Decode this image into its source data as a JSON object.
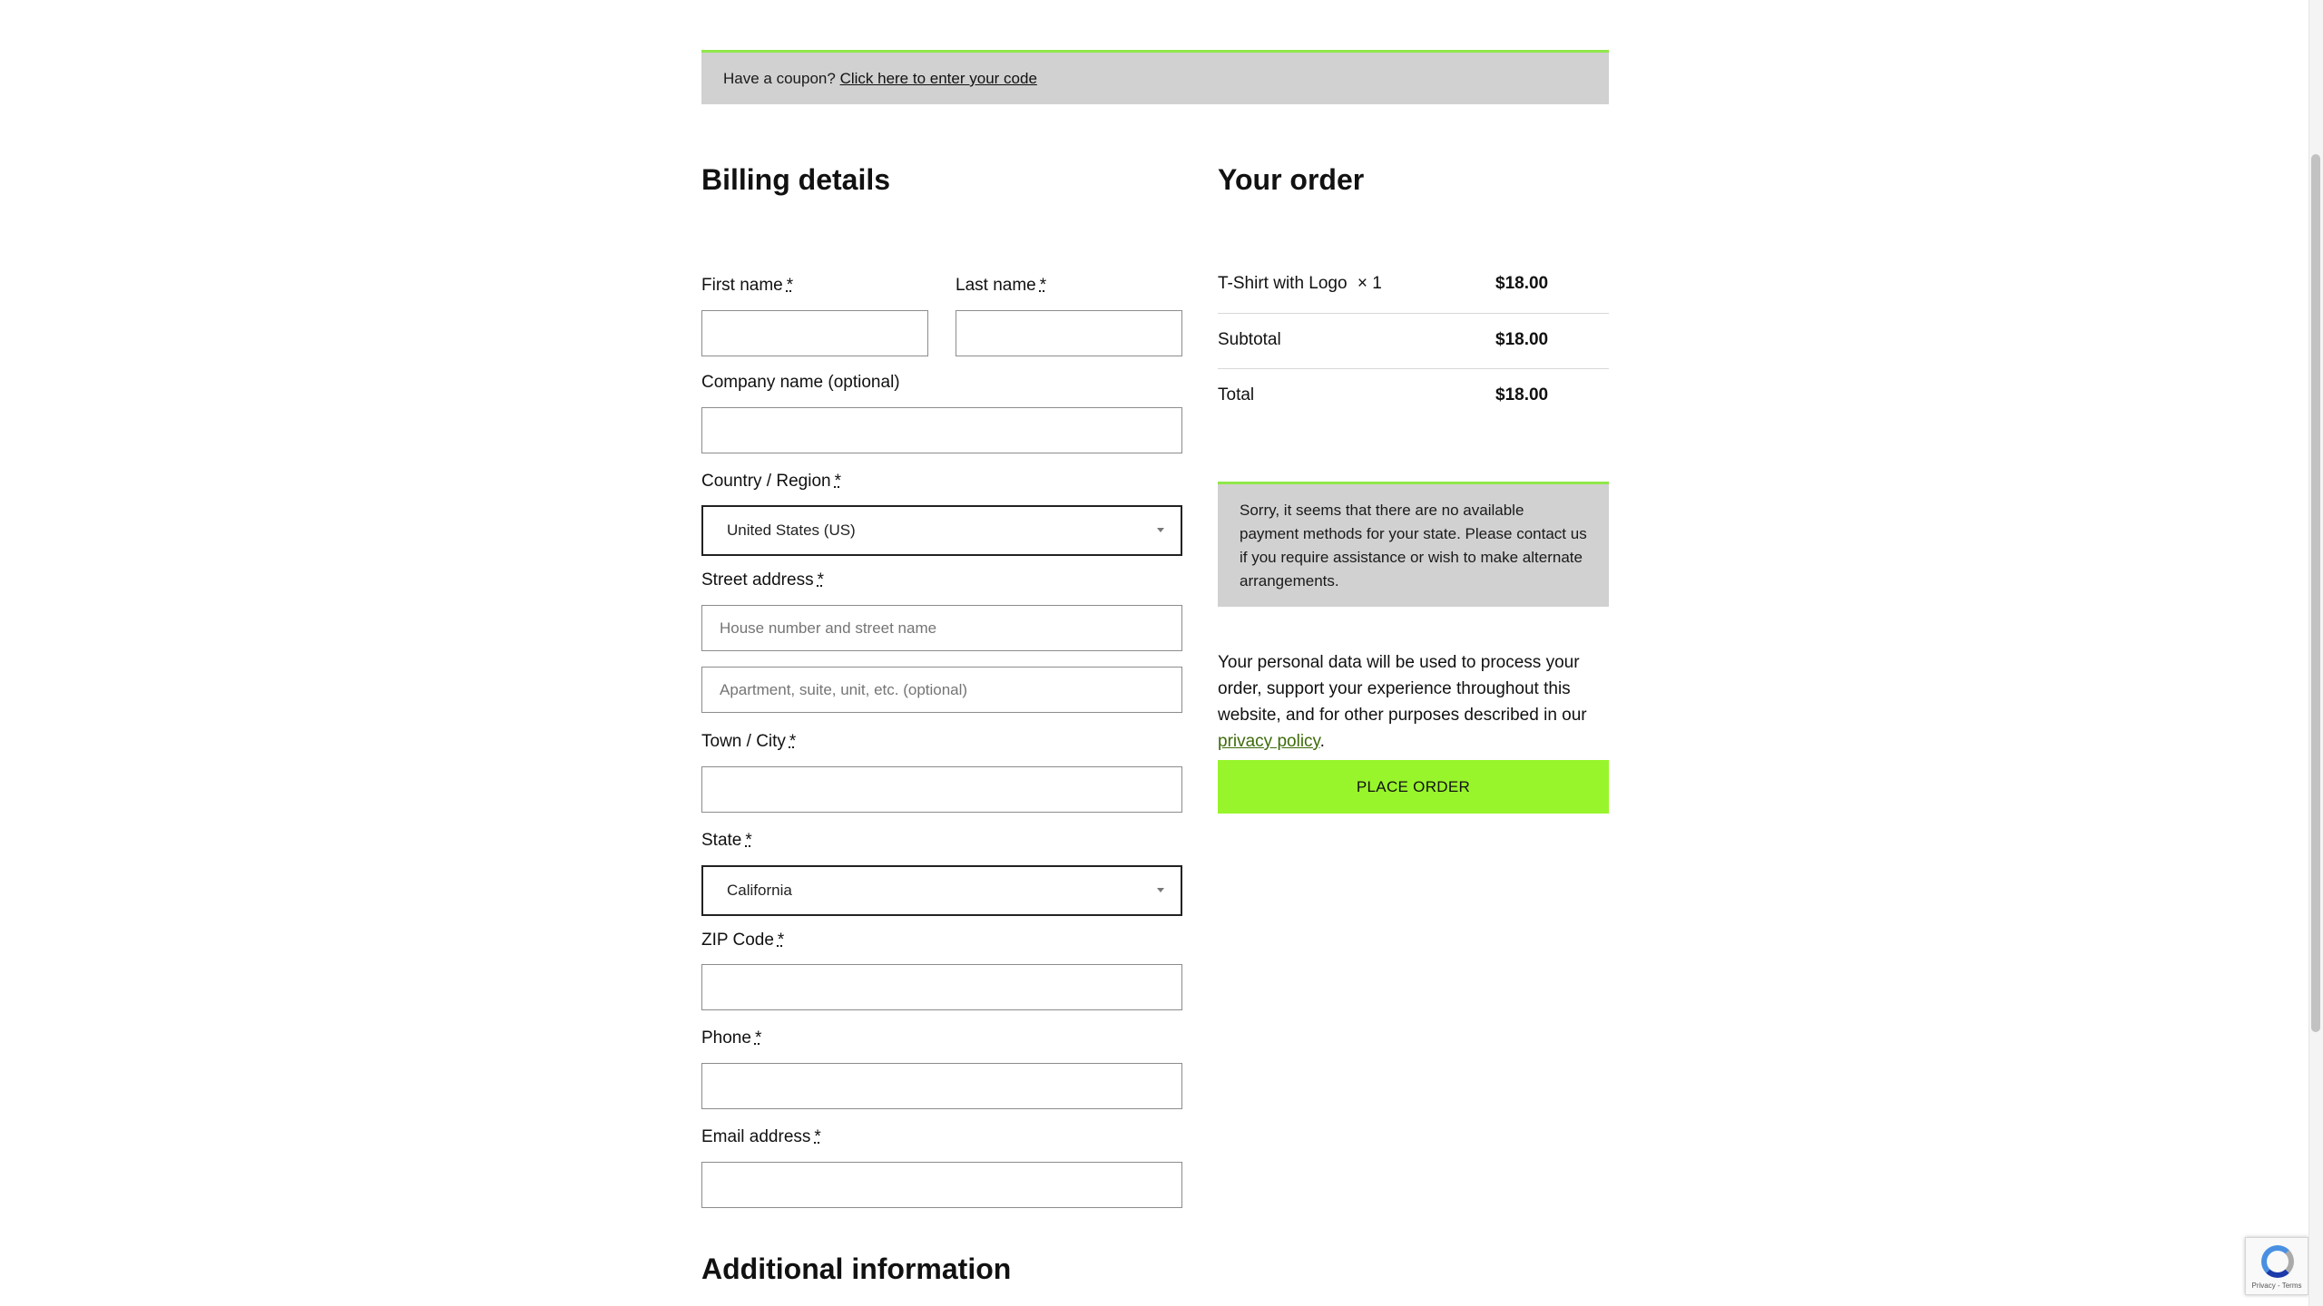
{
  "coupon": {
    "prompt": "Have a coupon?",
    "link": "Click here to enter your code"
  },
  "billing": {
    "title": "Billing details",
    "first_name_label": "First name",
    "last_name_label": "Last name",
    "company_label": "Company name (optional)",
    "country_label": "Country / Region",
    "country_value": "United States (US)",
    "street_label": "Street address",
    "street_placeholder": "House number and street name",
    "street2_placeholder": "Apartment, suite, unit, etc. (optional)",
    "city_label": "Town / City",
    "state_label": "State",
    "state_value": "California",
    "zip_label": "ZIP Code",
    "phone_label": "Phone",
    "email_label": "Email address",
    "required_marker": "*"
  },
  "additional": {
    "title": "Additional information"
  },
  "order": {
    "title": "Your order",
    "item_name": "T-Shirt with Logo",
    "item_qty": "× 1",
    "item_price": "$18.00",
    "subtotal_label": "Subtotal",
    "subtotal_value": "$18.00",
    "total_label": "Total",
    "total_value": "$18.00",
    "payment_notice": "Sorry, it seems that there are no available payment methods for your state. Please contact us if you require assistance or wish to make alternate arrangements.",
    "privacy_before": "Your personal data will be used to process your order, support your experience throughout this website, and for other purposes described in our",
    "privacy_link": "privacy policy",
    "privacy_after": ".",
    "place_order_label": "PLACE ORDER"
  },
  "recaptcha": {
    "terms": "Privacy - Terms"
  },
  "colors": {
    "accent": "#98f52b",
    "notice_background": "#d1d1d1",
    "notice_border": "#8fe84a"
  }
}
